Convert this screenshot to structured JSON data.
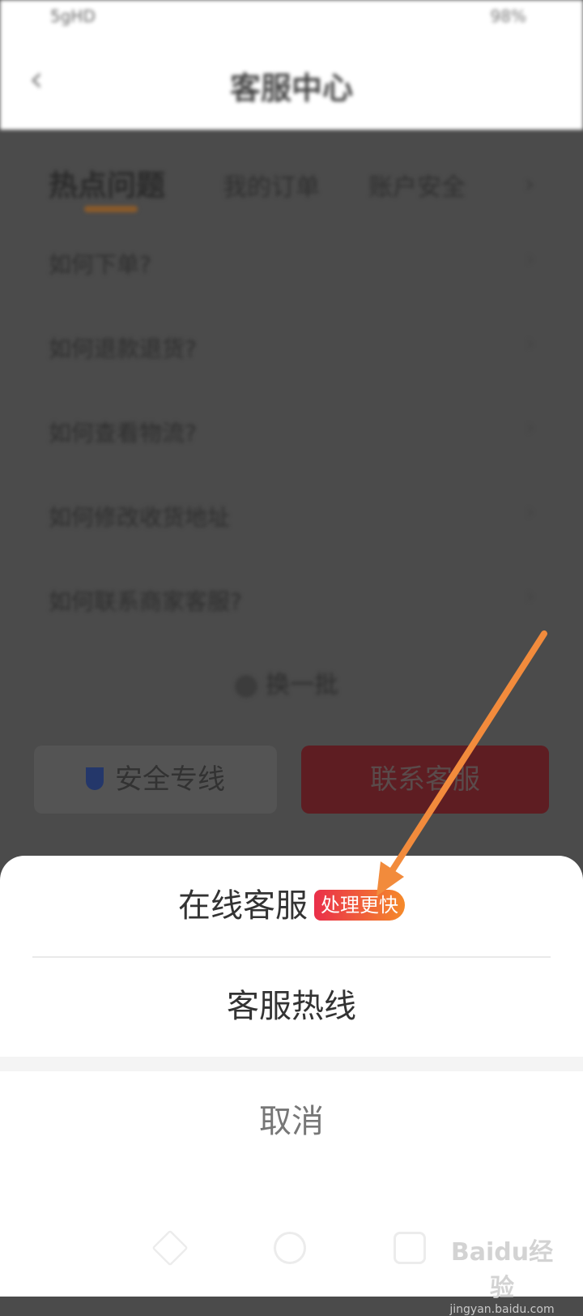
{
  "status_bar": {
    "left": "5gHD",
    "right": "98%"
  },
  "header": {
    "title": "客服中心"
  },
  "tabs": {
    "items": [
      {
        "label": "热点问题"
      },
      {
        "label": "我的订单"
      },
      {
        "label": "账户安全"
      }
    ]
  },
  "faq": {
    "items": [
      {
        "label": "如何下单?"
      },
      {
        "label": "如何退款退货?"
      },
      {
        "label": "如何查看物流?"
      },
      {
        "label": "如何修改收货地址"
      },
      {
        "label": "如何联系商家客服?"
      }
    ]
  },
  "switch_label": "换一批",
  "footer_buttons": {
    "secure_line": "安全专线",
    "contact": "联系客服"
  },
  "action_sheet": {
    "online_service": "在线客服",
    "online_badge": "处理更快",
    "hotline": "客服热线",
    "cancel": "取消"
  },
  "watermark": {
    "logo": "Baidu经验",
    "url": "jingyan.baidu.com"
  },
  "colors": {
    "badge_start": "#ea2f4a",
    "badge_end": "#f58a2a",
    "annotation_arrow": "#f28b3c",
    "contact_button": "#5e1d22"
  }
}
